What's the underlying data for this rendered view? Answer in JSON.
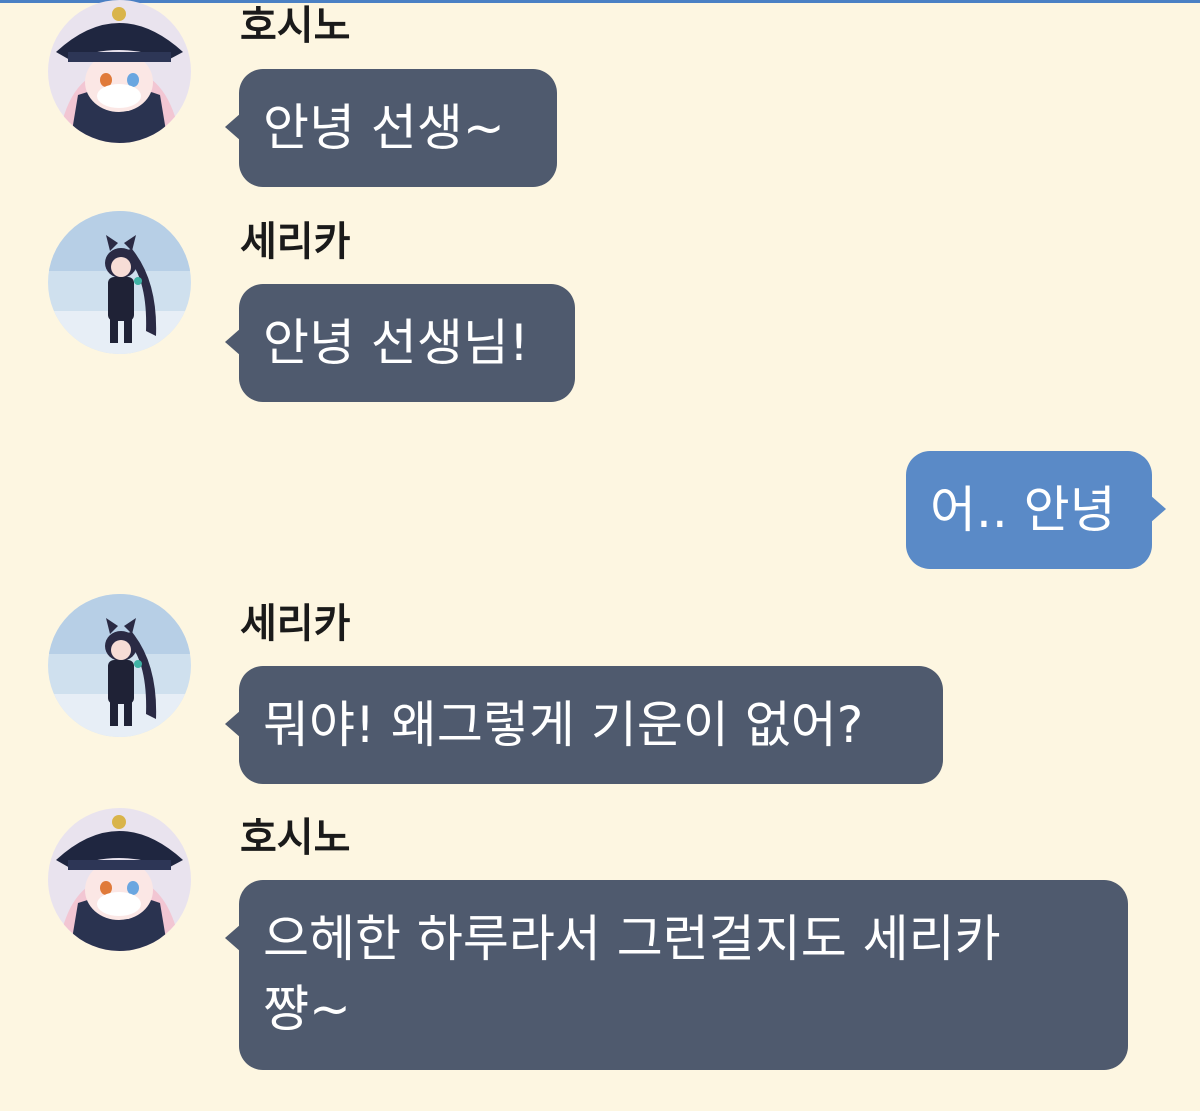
{
  "theme": {
    "background": "#fdf6e1",
    "top_border": "#4a80c4",
    "incoming_bubble": "#4f5a6e",
    "outgoing_bubble": "#5a8ac7"
  },
  "messages": [
    {
      "sender": "호시노",
      "avatar_icon": "hoshino-avatar",
      "direction": "incoming",
      "text": "안녕 선생~"
    },
    {
      "sender": "세리카",
      "avatar_icon": "serika-avatar",
      "direction": "incoming",
      "text": "안녕 선생님!"
    },
    {
      "direction": "outgoing",
      "text": "어.. 안녕"
    },
    {
      "sender": "세리카",
      "avatar_icon": "serika-avatar",
      "direction": "incoming",
      "text": "뭐야! 왜그렇게 기운이 없어?"
    },
    {
      "sender": "호시노",
      "avatar_icon": "hoshino-avatar",
      "direction": "incoming",
      "text": "으헤한 하루라서 그런걸지도 세리카\n쨩~"
    }
  ]
}
